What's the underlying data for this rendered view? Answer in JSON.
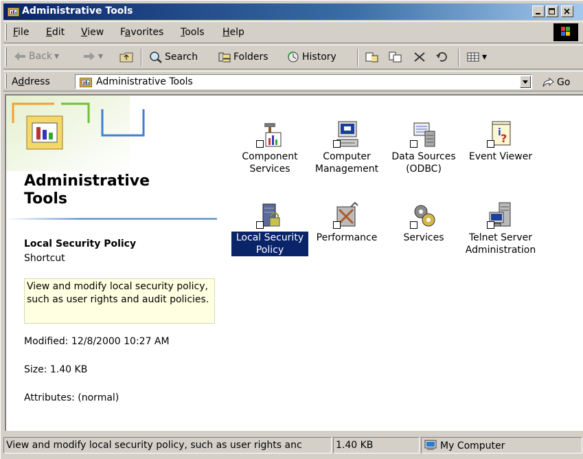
{
  "window": {
    "title": "Administrative Tools"
  },
  "menu": [
    "File",
    "Edit",
    "View",
    "Favorites",
    "Tools",
    "Help"
  ],
  "menu_mnemonics": [
    "F",
    "E",
    "V",
    "a",
    "T",
    "H"
  ],
  "toolbar": {
    "back": "Back",
    "search": "Search",
    "folders": "Folders",
    "history": "History"
  },
  "address": {
    "label": "Address",
    "label_mnemonic": "d",
    "value": "Administrative Tools",
    "go": "Go"
  },
  "left_pane": {
    "heading_line1": "Administrative",
    "heading_line2": "Tools",
    "selected_name": "Local Security Policy",
    "selected_type": "Shortcut",
    "infotip": "View and modify local security policy, such as user rights and audit policies.",
    "modified": "Modified: 12/8/2000 10:27 AM",
    "size": "Size: 1.40 KB",
    "attributes": "Attributes: (normal)"
  },
  "icons": [
    {
      "label": "Component Services",
      "icon": "component-services-icon"
    },
    {
      "label": "Computer Management",
      "icon": "computer-management-icon"
    },
    {
      "label": "Data Sources (ODBC)",
      "icon": "data-sources-icon"
    },
    {
      "label": "Event Viewer",
      "icon": "event-viewer-icon"
    },
    {
      "label": "Local Security Policy",
      "icon": "local-security-policy-icon",
      "selected": true
    },
    {
      "label": "Performance",
      "icon": "performance-icon"
    },
    {
      "label": "Services",
      "icon": "services-icon"
    },
    {
      "label": "Telnet Server Administration",
      "icon": "telnet-server-icon"
    }
  ],
  "status": {
    "text": "View and modify local security policy, such as user rights anc",
    "size": "1.40 KB",
    "zone": "My Computer"
  },
  "colors": {
    "title_active": "#0a246a",
    "selection": "#0a246a",
    "infotip_bg": "#ffffe1",
    "face": "#d4d0c8"
  }
}
